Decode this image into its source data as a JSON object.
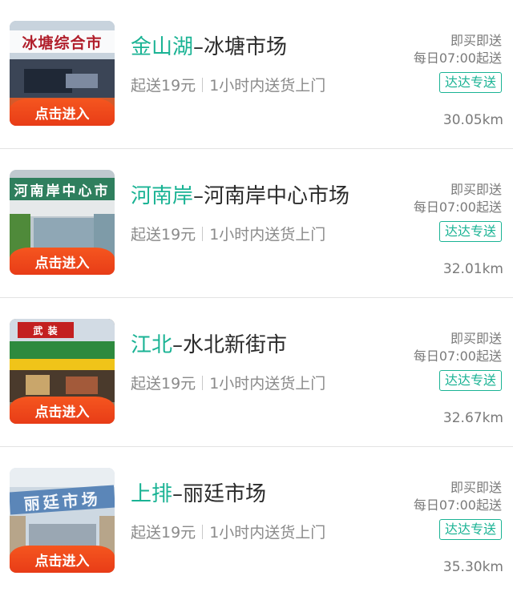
{
  "markets": [
    {
      "area": "金山湖",
      "name": "–冰塘市场",
      "sign_text": "冰塘综合市",
      "enter_label": "点击进入",
      "min_order": "起送19元",
      "delivery": "1小时内送货上门",
      "mode": "即买即送",
      "hours": "每日07:00起送",
      "badge": "达达专送",
      "distance": "30.05km"
    },
    {
      "area": "河南岸",
      "name": "–河南岸中心市场",
      "sign_text": "河南岸中心市",
      "enter_label": "点击进入",
      "min_order": "起送19元",
      "delivery": "1小时内送货上门",
      "mode": "即买即送",
      "hours": "每日07:00起送",
      "badge": "达达专送",
      "distance": "32.01km"
    },
    {
      "area": "江北",
      "name": "–水北新街市",
      "sign_text": "武 装",
      "enter_label": "点击进入",
      "min_order": "起送19元",
      "delivery": "1小时内送货上门",
      "mode": "即买即送",
      "hours": "每日07:00起送",
      "badge": "达达专送",
      "distance": "32.67km"
    },
    {
      "area": "上排",
      "name": "–丽廷市场",
      "sign_text": "丽廷市场",
      "enter_label": "点击进入",
      "min_order": "起送19元",
      "delivery": "1小时内送货上门",
      "mode": "即买即送",
      "hours": "每日07:00起送",
      "badge": "达达专送",
      "distance": "35.30km"
    }
  ],
  "colors": {
    "accent": "#1ab394",
    "button": "#f04a1c",
    "text": "#2b2b2b",
    "muted": "#8a8a8a"
  }
}
